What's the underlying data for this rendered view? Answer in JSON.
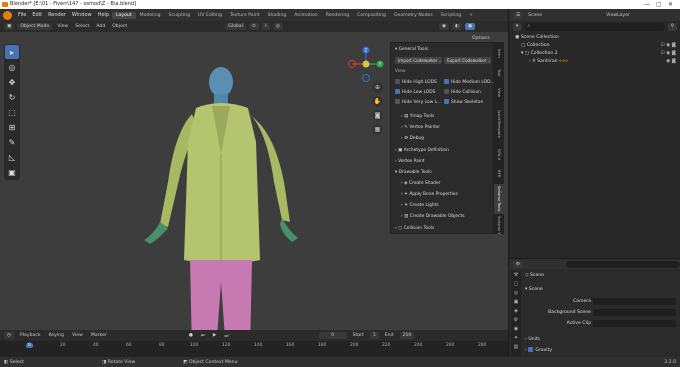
{
  "window": {
    "title": "Blender* [E:\\01 - Fiverr\\147 - osmod\\Z - B\\a.blend]",
    "controls": [
      "—",
      "▢",
      "✕"
    ]
  },
  "menu": {
    "items": [
      "File",
      "Edit",
      "Render",
      "Window",
      "Help"
    ]
  },
  "workspaces": [
    "Layout",
    "Modeling",
    "Sculpting",
    "UV Editing",
    "Texture Paint",
    "Shading",
    "Animation",
    "Rendering",
    "Compositing",
    "Geometry Nodes",
    "Scripting"
  ],
  "active_workspace": "Layout",
  "scene": {
    "label": "Scene",
    "view_layer": "ViewLayer"
  },
  "viewport_header": {
    "mode": "Object Mode",
    "items": [
      "View",
      "Select",
      "Add",
      "Object"
    ],
    "orientation": "Global",
    "options": "Options"
  },
  "gizmo": {
    "x": "X",
    "y": "Y",
    "z": "Z"
  },
  "npanel": {
    "general_tools": "General Tools",
    "import_btn": "Import Codewalker ...",
    "export_btn": "Export Codewalker ...",
    "view": "View",
    "checks": [
      {
        "label": "Hide High LODS",
        "on": false
      },
      {
        "label": "Hide Medium LOD...",
        "on": true
      },
      {
        "label": "Hide Low LODS",
        "on": true
      },
      {
        "label": "Hide Collision",
        "on": false
      },
      {
        "label": "Hide Very Low L...",
        "on": false
      },
      {
        "label": "Show Skeleton",
        "on": true
      }
    ],
    "sub_items": [
      "Ymap Tools",
      "Vertex Painter",
      "Debug"
    ],
    "archetype": "Archetype Definition",
    "vertex_paint": "Vertex Paint",
    "drawable_tools": "Drawable Tools",
    "drawable_items": [
      "Create Shader",
      "Apply Bone Properties",
      "Create Lights",
      "Create Drawable Objects"
    ],
    "collision_tools": "Collision Tools"
  },
  "npanel_tabs": [
    "Item",
    "Tool",
    "View",
    "QuickTemplate",
    "GTA V",
    "BFR",
    "Sollumz Tools",
    "Sollumz Ytd"
  ],
  "active_npanel_tab": "Sollumz Tools",
  "outliner": {
    "rows": [
      "Scene Collection",
      "Collection",
      "Collection 2",
      "Sanhiran"
    ],
    "search_placeholder": ""
  },
  "properties": {
    "header": "Scene",
    "section": "Scene",
    "fields": [
      "Camera",
      "Background Scene",
      "Active Clip"
    ],
    "subsections": [
      "Units",
      "Gravity"
    ]
  },
  "timeline": {
    "items": [
      "Playback",
      "Keying",
      "View",
      "Marker"
    ],
    "current_frame": "0",
    "start_label": "Start",
    "start": "1",
    "end_label": "End",
    "end": "250",
    "ticks": [
      "0",
      "20",
      "40",
      "60",
      "80",
      "100",
      "120",
      "140",
      "160",
      "180",
      "200",
      "220",
      "240",
      "260",
      "280"
    ]
  },
  "status": {
    "items": [
      "Select",
      "Rotate View",
      "Object Context Menu"
    ],
    "version": "3.2.0"
  },
  "colors": {
    "accent": "#4772b3",
    "orange": "#e87d0d",
    "header": "#303030",
    "viewport": "#3d3d3d",
    "jacket": "#b5c46e",
    "pants": "#c77ab1",
    "skin": "#5a8fb3"
  }
}
